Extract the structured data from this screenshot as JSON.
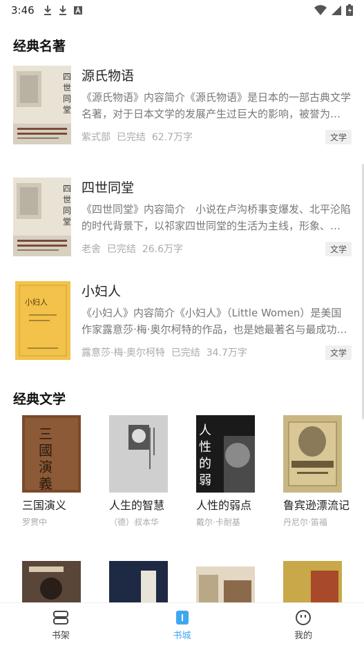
{
  "status_bar": {
    "time": "3:46"
  },
  "sections": {
    "classics": {
      "title": "经典名著",
      "books": [
        {
          "title": "源氏物语",
          "desc": "《源氏物语》内容简介《源氏物语》是日本的一部古典文学名著，对于日本文学的发展产生过巨大的影响，被誉为…",
          "author": "紫式部",
          "status": "已完结",
          "words": "62.7万字",
          "tag": "文学",
          "cover_text": "四世同堂"
        },
        {
          "title": "四世同堂",
          "desc": "《四世同堂》内容简介　小说在卢沟桥事变爆发、北平沦陷的时代背景下，以祁家四世同堂的生活为主线，形象、…",
          "author": "老舍",
          "status": "已完结",
          "words": "26.6万字",
          "tag": "文学",
          "cover_text": "四世同堂"
        },
        {
          "title": "小妇人",
          "desc": "《小妇人》内容简介《小妇人》（Little Women）是美国作家露意莎·梅·奥尔柯特的作品，也是她最著名与最成功…",
          "author": "露意莎·梅·奥尔柯特",
          "status": "已完结",
          "words": "34.7万字",
          "tag": "文学",
          "cover_text": "小妇人"
        }
      ]
    },
    "literature": {
      "title": "经典文学",
      "books": [
        {
          "title": "三国演义",
          "author": "罗贯中",
          "cover_text": "三國演義"
        },
        {
          "title": "人生的智慧",
          "author": "（德）叔本华",
          "cover_text": "人生的智慧"
        },
        {
          "title": "人性的弱点",
          "author": "戴尔·卡耐基",
          "cover_text": "人性的弱点"
        },
        {
          "title": "鲁宾逊漂流记",
          "author": "丹尼尔·笛福",
          "cover_text": "鲁宾逊漂流记"
        }
      ]
    }
  },
  "bottom_nav": {
    "items": [
      {
        "label": "书架",
        "icon": "bookshelf-icon"
      },
      {
        "label": "书城",
        "icon": "bookstore-icon"
      },
      {
        "label": "我的",
        "icon": "profile-icon"
      }
    ],
    "active_color": "#3fa7f0"
  }
}
